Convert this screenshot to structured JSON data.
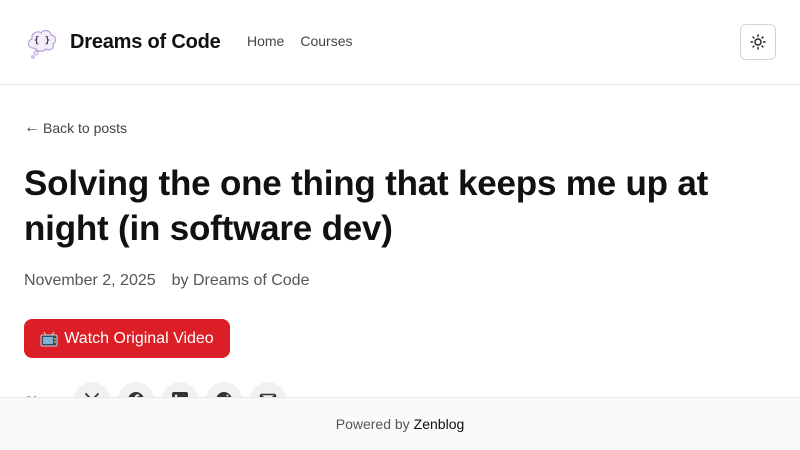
{
  "site": {
    "name": "Dreams of Code",
    "logo_icon": "brain-cloud-logo-icon"
  },
  "nav": {
    "items": [
      {
        "label": "Home"
      },
      {
        "label": "Courses"
      }
    ],
    "theme_toggle_icon": "sun-icon"
  },
  "post": {
    "back_label": "Back to posts",
    "back_icon": "arrow-left-icon",
    "title": "Solving the one thing that keeps me up at night (in software dev)",
    "date": "November 2, 2025",
    "author": "by Dreams of Code",
    "watch_button": {
      "icon": "tv-icon",
      "label": "Watch Original Video",
      "color": "#dc1f26"
    },
    "share": {
      "label": "Share:",
      "icons": [
        "x-icon",
        "facebook-icon",
        "linkedin-icon",
        "reddit-icon",
        "email-icon"
      ]
    }
  },
  "footer": {
    "prefix": "Powered by",
    "link": "Zenblog"
  }
}
